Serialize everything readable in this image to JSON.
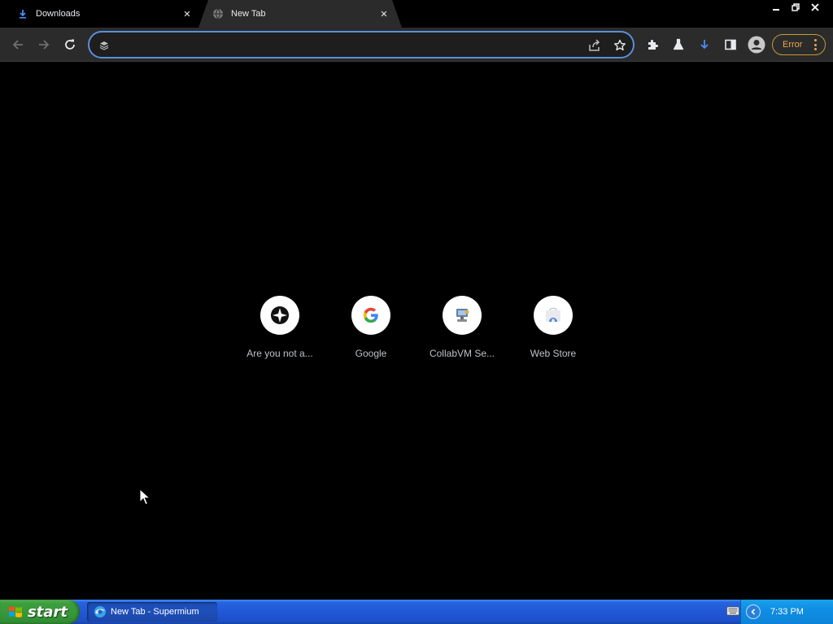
{
  "tabs": [
    {
      "title": "Downloads",
      "icon": "download-icon",
      "close": "✕"
    },
    {
      "title": "New Tab",
      "icon": "globe-icon",
      "close": "✕"
    }
  ],
  "window_controls": {
    "minimize": "—",
    "restore": "❐",
    "close": "✕"
  },
  "omnibox": {
    "value": "",
    "placeholder": ""
  },
  "profile_status": {
    "label": "Error"
  },
  "shortcuts": [
    {
      "label": "Are you not a...",
      "icon": "compass-star-icon"
    },
    {
      "label": "Google",
      "icon": "google-g-icon"
    },
    {
      "label": "CollabVM Se...",
      "icon": "collabvm-icon"
    },
    {
      "label": "Web Store",
      "icon": "web-store-icon"
    }
  ],
  "taskbar": {
    "start_label": "start",
    "task_item": "New Tab - Supermium",
    "clock": "7:33 PM"
  },
  "colors": {
    "accent": "#5a8fd8",
    "error": "#e8a94a",
    "download": "#4285f4"
  }
}
